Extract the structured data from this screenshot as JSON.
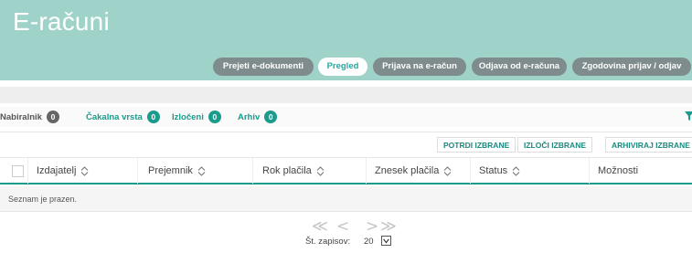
{
  "app": {
    "title": "E-računi"
  },
  "nav": {
    "tabs": [
      {
        "label": "Prejeti e-dokumenti",
        "active": false
      },
      {
        "label": "Pregled",
        "active": true
      },
      {
        "label": "Prijava na e-račun",
        "active": false
      },
      {
        "label": "Odjava od e-računa",
        "active": false
      },
      {
        "label": "Zgodovina prijav / odjav",
        "active": false
      }
    ]
  },
  "filters": {
    "items": [
      {
        "label": "Nabiralnik",
        "count": "0",
        "color": "#666666"
      },
      {
        "label": "Čakalna vrsta",
        "count": "0",
        "color": "#1a9b8b"
      },
      {
        "label": "Izločeni",
        "count": "0",
        "color": "#1a9b8b"
      },
      {
        "label": "Arhiv",
        "count": "0",
        "color": "#1a9b8b"
      }
    ],
    "filter_icon": "funnel-icon"
  },
  "actions": {
    "confirm": "POTRDI IZBRANE",
    "exclude": "IZLOČI IZBRANE",
    "archive": "ARHIVIRAJ IZBRANE"
  },
  "table": {
    "columns": [
      {
        "label": "Izdajatelj",
        "sortable": true
      },
      {
        "label": "Prejemnik",
        "sortable": true
      },
      {
        "label": "Rok plačila",
        "sortable": true
      },
      {
        "label": "Znesek plačila",
        "sortable": true
      },
      {
        "label": "Status",
        "sortable": true
      },
      {
        "label": "Možnosti",
        "sortable": false
      }
    ],
    "empty_message": "Seznam je prazen."
  },
  "pagination": {
    "first": "≪",
    "prev": "<",
    "next": ">",
    "last": "≫",
    "records_label": "Št. zapisov:",
    "records_value": "20"
  },
  "colors": {
    "header_bg": "#9fd3c9",
    "accent": "#1a9b8b",
    "tab_bg": "#7f8c8d"
  }
}
